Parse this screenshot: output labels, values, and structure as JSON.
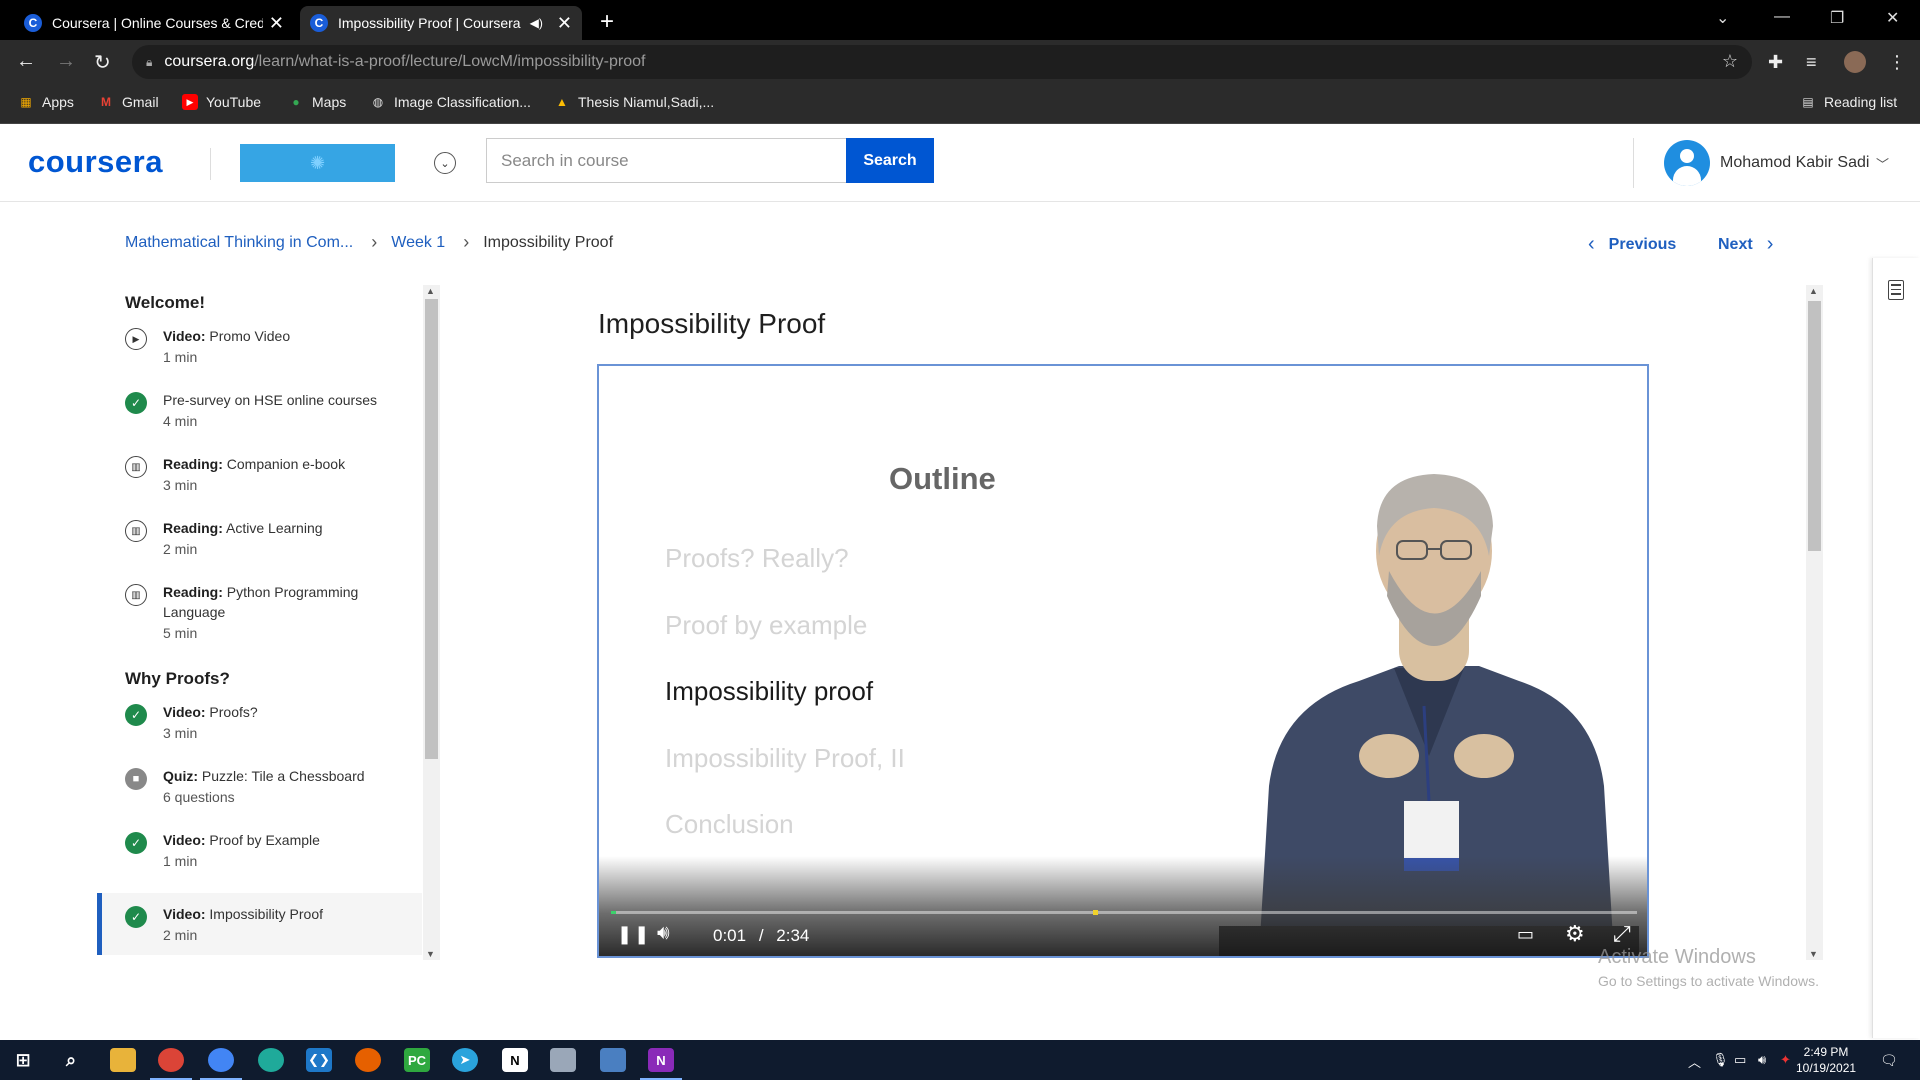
{
  "browser": {
    "tabs": [
      {
        "title": "Coursera | Online Courses & Credentials",
        "favicon": "C"
      },
      {
        "title": "Impossibility Proof | Coursera",
        "favicon": "C"
      }
    ],
    "url_host": "coursera.org",
    "url_path": "/learn/what-is-a-proof/lecture/LowcM/impossibility-proof",
    "bookmarks": [
      "Apps",
      "Gmail",
      "YouTube",
      "Maps",
      "Image Classification...",
      "Thesis Niamul,Sadi,..."
    ],
    "reading_list": "Reading list"
  },
  "header": {
    "logo": "coursera",
    "search_placeholder": "Search in course",
    "search_button": "Search",
    "user_name": "Mohamod Kabir Sadi"
  },
  "breadcrumb": {
    "course": "Mathematical Thinking in Com...",
    "week": "Week 1",
    "current": "Impossibility Proof"
  },
  "nav": {
    "previous": "Previous",
    "next": "Next"
  },
  "sidebar": {
    "sections": [
      {
        "title": "Welcome!",
        "items": [
          {
            "type": "Video:",
            "name": "Promo Video",
            "meta": "1 min",
            "status": "play"
          },
          {
            "type": "",
            "name": "Pre-survey on HSE online courses",
            "meta": "4 min",
            "status": "done"
          },
          {
            "type": "Reading:",
            "name": "Companion e-book",
            "meta": "3 min",
            "status": "book"
          },
          {
            "type": "Reading:",
            "name": "Active Learning",
            "meta": "2 min",
            "status": "book"
          },
          {
            "type": "Reading:",
            "name": "Python Programming Language",
            "meta": "5 min",
            "status": "book"
          }
        ]
      },
      {
        "title": "Why Proofs?",
        "items": [
          {
            "type": "Video:",
            "name": "Proofs?",
            "meta": "3 min",
            "status": "done"
          },
          {
            "type": "Quiz:",
            "name": "Puzzle: Tile a Chessboard",
            "meta": "6 questions",
            "status": "lock"
          },
          {
            "type": "Video:",
            "name": "Proof by Example",
            "meta": "1 min",
            "status": "done"
          },
          {
            "type": "Video:",
            "name": "Impossibility Proof",
            "meta": "2 min",
            "status": "done"
          }
        ]
      }
    ]
  },
  "main": {
    "title": "Impossibility Proof",
    "slide": {
      "heading": "Outline",
      "items": [
        "Proofs? Really?",
        "Proof by example",
        "Impossibility proof",
        "Impossibility Proof, II",
        "Conclusion"
      ],
      "current_index": 2
    },
    "player": {
      "current_time": "0:01",
      "separator": "/",
      "duration": "2:34",
      "progress": 0.005,
      "buffer_mark": 0.47
    }
  },
  "watermark": {
    "line1": "Activate Windows",
    "line2": "Go to Settings to activate Windows."
  },
  "taskbar": {
    "time": "2:49 PM",
    "date": "10/19/2021"
  },
  "colors": {
    "coursera_blue": "#0056d2",
    "link_blue": "#1f5fbf",
    "complete_green": "#1f8a4c",
    "player_border": "#6a93d6"
  }
}
